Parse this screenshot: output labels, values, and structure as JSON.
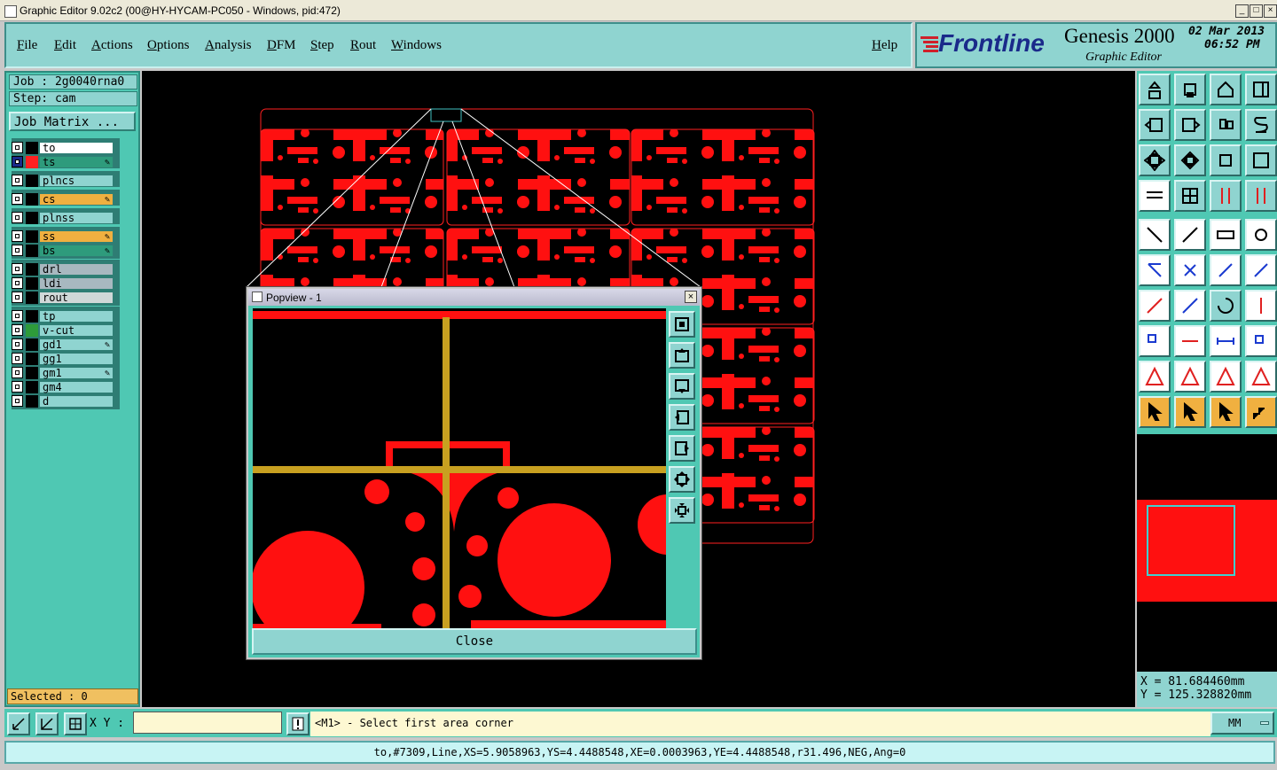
{
  "window": {
    "title": "Graphic Editor 9.02c2 (00@HY-HYCAM-PC050 - Windows, pid:472)"
  },
  "menu": {
    "items": [
      "File",
      "Edit",
      "Actions",
      "Options",
      "Analysis",
      "DFM",
      "Step",
      "Rout",
      "Windows"
    ],
    "help": "Help"
  },
  "brand": {
    "logo": "Frontline",
    "product": "Genesis 2000",
    "subtitle": "Graphic Editor",
    "date": "02 Mar 2013",
    "time": "06:52 PM"
  },
  "job": {
    "job": "Job : 2g0040rna0",
    "step": "Step: cam",
    "matrix_button": "Job Matrix ..."
  },
  "layers": [
    {
      "name": "to",
      "color": "#000000",
      "bg": "#ffffff",
      "mark": false
    },
    {
      "name": "ts",
      "color": "#ff2020",
      "bg": "#2e9b7c",
      "mark": true,
      "selected": true
    },
    {
      "name": "plncs",
      "color": "#000000",
      "bg": "#8fd4d0",
      "mark": false
    },
    {
      "name": "cs",
      "color": "#000000",
      "bg": "#f0b040",
      "mark": true
    },
    {
      "name": "plnss",
      "color": "#000000",
      "bg": "#8fd4d0",
      "mark": false
    },
    {
      "name": "ss",
      "color": "#000000",
      "bg": "#f0b040",
      "mark": true
    },
    {
      "name": "bs",
      "color": "#000000",
      "bg": "#2e9b7c",
      "mark": true
    },
    {
      "name": "drl",
      "color": "#000000",
      "bg": "#a8b8c0",
      "mark": false
    },
    {
      "name": "ldi",
      "color": "#000000",
      "bg": "#a8b8c0",
      "mark": false
    },
    {
      "name": "rout",
      "color": "#000000",
      "bg": "#d0d8d8",
      "mark": false
    },
    {
      "name": "tp",
      "color": "#000000",
      "bg": "#8fd4d0",
      "mark": false
    },
    {
      "name": "v-cut",
      "color": "#2e9b3a",
      "bg": "#8fd4d0",
      "mark": false
    },
    {
      "name": "gd1",
      "color": "#000000",
      "bg": "#8fd4d0",
      "mark": true
    },
    {
      "name": "gg1",
      "color": "#000000",
      "bg": "#8fd4d0",
      "mark": false
    },
    {
      "name": "gm1",
      "color": "#000000",
      "bg": "#8fd4d0",
      "mark": true
    },
    {
      "name": "gm4",
      "color": "#000000",
      "bg": "#8fd4d0",
      "mark": false
    },
    {
      "name": "d",
      "color": "#000000",
      "bg": "#8fd4d0",
      "mark": false
    }
  ],
  "selected_text": "Selected : 0",
  "popview": {
    "title": "Popview - 1",
    "close_label": "Close"
  },
  "coords": {
    "x": "X = 81.684460mm",
    "y": "Y = 125.328820mm"
  },
  "bottom": {
    "xy_label": "X Y :",
    "xy_value": "",
    "prompt": "<M1> - Select first area corner",
    "units": "MM"
  },
  "status_line": "to,#7309,Line,XS=5.9058963,YS=4.4488548,XE=0.0003963,YE=4.4488548,r31.496,NEG,Ang=0",
  "colors": {
    "accent": "#4fc8b3",
    "panel": "#8fd4d0",
    "pcb_red": "#ff1010",
    "cursor_gold": "#c8a020"
  },
  "icons": [
    "window-icon",
    "minimize-icon",
    "maximize-icon",
    "close-icon"
  ]
}
